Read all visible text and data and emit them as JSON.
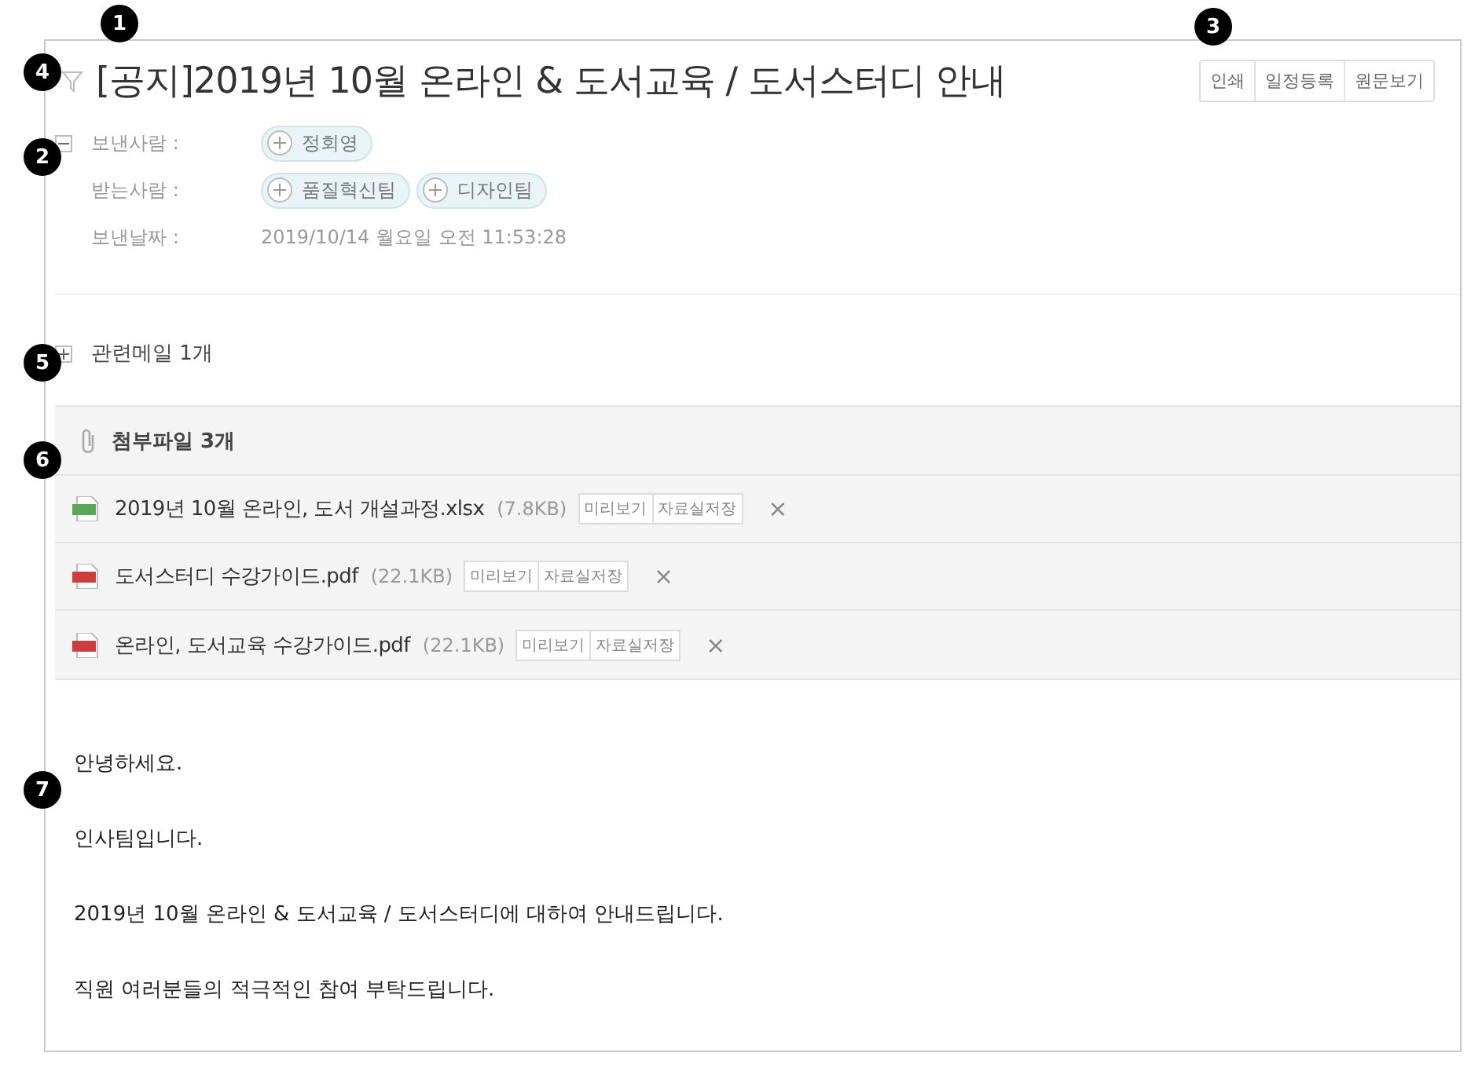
{
  "mail": {
    "title": "[공지]2019년 10월 온라인 & 도서교육 / 도서스터디 안내",
    "flagged": false,
    "actions": [
      "인쇄",
      "일정등록",
      "원문보기"
    ],
    "header_expanded": true,
    "sender": {
      "label": "보낸사람 :",
      "chips": [
        "정회영"
      ]
    },
    "recipients": {
      "label": "받는사람 :",
      "chips": [
        "품질혁신팀",
        "디자인팀"
      ]
    },
    "date": {
      "label": "보낸날짜 :",
      "value": "2019/10/14 월요일 오전 11:53:28"
    },
    "related": {
      "label": "관련메일 1개",
      "expanded": false
    },
    "attachments": {
      "title": "첨부파일 3개",
      "files": [
        {
          "kind": "xls",
          "name": "2019년 10월 온라인, 도서 개설과정.xlsx",
          "size": "(7.8KB)",
          "preview": "미리보기",
          "save": "자료실저장",
          "remove": "×"
        },
        {
          "kind": "pdf",
          "name": "도서스터디 수강가이드.pdf",
          "size": "(22.1KB)",
          "preview": "미리보기",
          "save": "자료실저장",
          "remove": "×"
        },
        {
          "kind": "pdf",
          "name": "온라인, 도서교육 수강가이드.pdf",
          "size": "(22.1KB)",
          "preview": "미리보기",
          "save": "자료실저장",
          "remove": "×"
        }
      ]
    },
    "body": [
      "안녕하세요.",
      "인사팀입니다.",
      "2019년 10월 온라인 & 도서교육 / 도서스터디에 대하여 안내드립니다.",
      "직원 여러분들의 적극적인 참여 부탁드립니다."
    ]
  },
  "callouts": [
    "1",
    "2",
    "3",
    "4",
    "5",
    "6",
    "7"
  ]
}
